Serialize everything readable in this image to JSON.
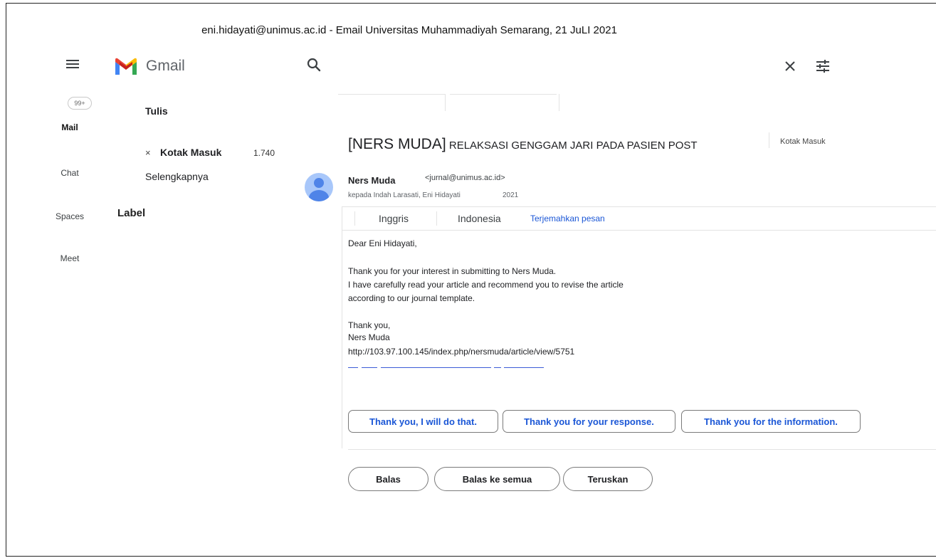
{
  "caption": "eni.hidayati@unimus.ac.id - Email Universitas Muhammadiyah Semarang, 21 JuLI 2021",
  "header": {
    "app_name": "Gmail",
    "icons": {
      "menu": "menu-icon",
      "search": "search-icon",
      "close": "close-icon",
      "filter": "tune-icon"
    },
    "brand_colors": {
      "red": "#ea4335",
      "blue": "#4285f4",
      "green": "#34a853",
      "yellow": "#fbbc04"
    }
  },
  "rail": {
    "badge": "99+",
    "items": [
      {
        "label": "Mail"
      },
      {
        "label": "Chat"
      },
      {
        "label": "Spaces"
      },
      {
        "label": "Meet"
      }
    ]
  },
  "nav": {
    "compose": "Tulis",
    "inbox_marker": "×",
    "inbox_label": "Kotak Masuk",
    "inbox_count": "1.740",
    "more": "Selengkapnya",
    "labels_heading": "Label"
  },
  "email": {
    "subject_prefix": "[NERS MUDA]",
    "subject_rest": " RELAKSASI GENGGAM JARI PADA PASIEN POST",
    "folder_chip": "Kotak Masuk",
    "sender_name": "Ners Muda",
    "sender_email": "<jurnal@unimus.ac.id>",
    "recipients": "kepada Indah Larasati, Eni Hidayati",
    "year": "2021",
    "translation": {
      "source": "Inggris",
      "target": "Indonesia",
      "link": "Terjemahkan pesan",
      "link_color": "#1a56d6"
    },
    "body": {
      "greeting": "Dear Eni Hidayati,",
      "line1": "Thank you for your interest in submitting to Ners Muda.",
      "line2": "I have carefully read your article and recommend you to revise the article",
      "line3": "according to our journal template.",
      "closing": "Thank you,",
      "signature": "Ners Muda",
      "url": "http://103.97.100.145/index.php/nersmuda/article/view/5751"
    },
    "smart_replies": [
      "Thank you, I will do that.",
      "Thank you for your response.",
      "Thank you for the information."
    ],
    "actions": {
      "reply": "Balas",
      "reply_all": "Balas ke semua",
      "forward": "Teruskan"
    }
  }
}
